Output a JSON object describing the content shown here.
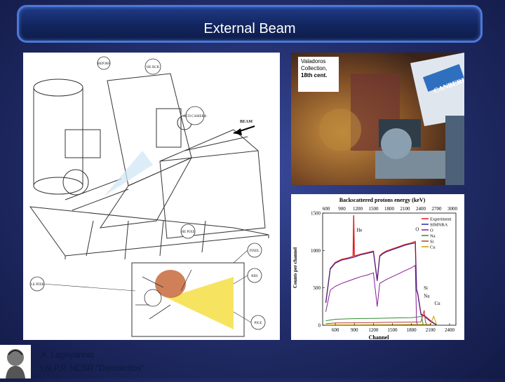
{
  "slide": {
    "title": "External Beam",
    "footer": {
      "author": "A. Lagoyannis",
      "institute": "I.N.P.P. NCSR “Demokritos”"
    },
    "logo_icon": "institute-logo-icon"
  },
  "drawing": {
    "labels": [
      "HEP3RF",
      "HE RCR",
      "CCD CAMERA",
      "BEAM",
      "HE PIXE",
      "PIXEL",
      "RBS",
      "LE-PIXE",
      "PIGE"
    ]
  },
  "photo": {
    "caption_line1": "Valadoros",
    "caption_line2": "Collection,",
    "caption_line3": "18th cent.",
    "brand_text": "CANBERRA"
  },
  "chart_data": {
    "type": "line",
    "title": "Backscattered protons energy (keV)",
    "xlabel": "Channel",
    "ylabel": "Counts per channel",
    "x_ticks": [
      "600",
      "900",
      "1200",
      "1500",
      "1800",
      "2100",
      "2400"
    ],
    "x_range": [
      400,
      2500
    ],
    "top_axis_ticks": [
      "600",
      "900",
      "1200",
      "1500",
      "1800",
      "2100",
      "2400",
      "2700",
      "3000"
    ],
    "y_ticks": [
      "0",
      "500",
      "1000",
      "1500"
    ],
    "ylim": [
      0,
      1500
    ],
    "legend": [
      "Experiment",
      "SIMNRA",
      "O",
      "Na",
      "Si",
      "Cu"
    ],
    "annotations": [
      "He",
      "O",
      "Si",
      "Na",
      "Cu"
    ],
    "colors": {
      "Experiment": "#e11b1b",
      "SIMNRA": "#2a2aa0",
      "O": "#8b1a9a",
      "Na": "#2f8f2f",
      "Si": "#b63a3a",
      "Cu": "#c8a000"
    },
    "series": [
      {
        "name": "Experiment",
        "x": [
          450,
          520,
          600,
          700,
          800,
          880,
          890,
          900,
          1000,
          1100,
          1200,
          1260,
          1300,
          1340,
          1400,
          1500,
          1600,
          1700,
          1800,
          1860,
          1880,
          1900,
          1950,
          2000,
          2100,
          2200
        ],
        "y": [
          300,
          760,
          840,
          880,
          900,
          920,
          1470,
          925,
          950,
          970,
          990,
          600,
          930,
          960,
          990,
          1020,
          1050,
          1080,
          1100,
          1120,
          480,
          420,
          150,
          130,
          60,
          0
        ]
      },
      {
        "name": "SIMNRA",
        "x": [
          450,
          520,
          600,
          700,
          800,
          900,
          1000,
          1100,
          1200,
          1260,
          1300,
          1340,
          1400,
          1500,
          1600,
          1700,
          1800,
          1860,
          1880,
          1900,
          1950,
          2000,
          2100,
          2200
        ],
        "y": [
          300,
          750,
          830,
          870,
          890,
          910,
          940,
          960,
          980,
          590,
          920,
          950,
          980,
          1010,
          1040,
          1070,
          1090,
          1100,
          470,
          410,
          140,
          120,
          50,
          0
        ]
      },
      {
        "name": "O",
        "x": [
          450,
          520,
          600,
          700,
          800,
          900,
          1000,
          1100,
          1200,
          1260,
          1300,
          1400,
          1500,
          1600,
          1700,
          1800,
          1860,
          1880,
          1900
        ],
        "y": [
          180,
          470,
          520,
          560,
          590,
          620,
          650,
          670,
          700,
          250,
          560,
          610,
          650,
          690,
          730,
          770,
          800,
          40,
          0
        ]
      },
      {
        "name": "Na",
        "x": [
          450,
          600,
          800,
          1000,
          1200,
          1400,
          1600,
          1800,
          1900,
          1960,
          1980,
          2000
        ],
        "y": [
          60,
          80,
          85,
          90,
          92,
          95,
          98,
          100,
          110,
          120,
          20,
          0
        ]
      },
      {
        "name": "Si",
        "x": [
          450,
          600,
          800,
          1000,
          1200,
          1400,
          1600,
          1800,
          1950,
          2000,
          2020,
          2050
        ],
        "y": [
          20,
          30,
          32,
          34,
          36,
          38,
          40,
          42,
          45,
          200,
          40,
          0
        ]
      },
      {
        "name": "Cu",
        "x": [
          450,
          800,
          1200,
          1600,
          2000,
          2100,
          2150,
          2200
        ],
        "y": [
          5,
          6,
          7,
          8,
          10,
          12,
          120,
          0
        ]
      }
    ]
  }
}
